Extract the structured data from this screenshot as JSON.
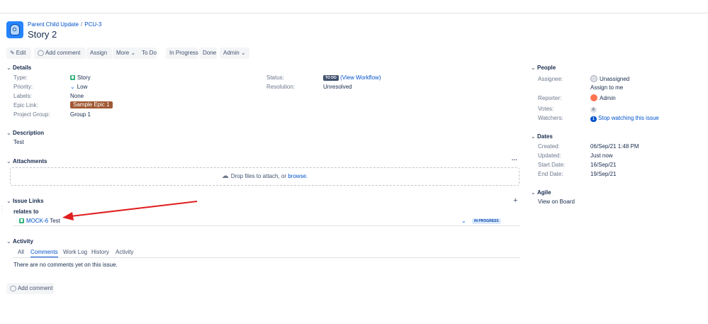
{
  "breadcrumb": {
    "project": "Parent Child Update",
    "issue_key": "PCU-3"
  },
  "issue": {
    "title": "Story 2"
  },
  "toolbar": {
    "edit": "Edit",
    "add_comment": "Add comment",
    "assign": "Assign",
    "more": "More",
    "todo": "To Do",
    "in_progress": "In Progress",
    "done": "Done",
    "admin": "Admin"
  },
  "details": {
    "heading": "Details",
    "type_label": "Type:",
    "type_value": "Story",
    "priority_label": "Priority:",
    "priority_value": "Low",
    "labels_label": "Labels:",
    "labels_value": "None",
    "epic_label": "Epic Link:",
    "epic_value": "Sample Epic 1",
    "group_label": "Project Group:",
    "group_value": "Group 1",
    "status_label": "Status:",
    "status_value": "TO DO",
    "view_workflow": "(View Workflow)",
    "resolution_label": "Resolution:",
    "resolution_value": "Unresolved"
  },
  "description": {
    "heading": "Description",
    "text": "Test"
  },
  "attachments": {
    "heading": "Attachments",
    "more": "···",
    "drop_text": "Drop files to attach, or",
    "browse": "browse."
  },
  "links": {
    "heading": "Issue Links",
    "add": "+",
    "relation": "relates to",
    "issue_key": "MOCK-6",
    "issue_summary": "Test",
    "status": "IN PROGRESS"
  },
  "activity": {
    "heading": "Activity",
    "tabs": [
      "All",
      "Comments",
      "Work Log",
      "History",
      "Activity"
    ],
    "empty": "There are no comments yet on this issue.",
    "add_comment": "Add comment"
  },
  "people": {
    "heading": "People",
    "assignee_label": "Assignee:",
    "assignee_value": "Unassigned",
    "assign_to_me": "Assign to me",
    "reporter_label": "Reporter:",
    "reporter_value": "Admin",
    "votes_label": "Votes:",
    "votes_value": "0",
    "watchers_label": "Watchers:",
    "watchers_count": "1",
    "watchers_action": "Stop watching this issue"
  },
  "dates": {
    "heading": "Dates",
    "created_label": "Created:",
    "created_value": "06/Sep/21 1:48 PM",
    "updated_label": "Updated:",
    "updated_value": "Just now",
    "start_label": "Start Date:",
    "start_value": "16/Sep/21",
    "end_label": "End Date:",
    "end_value": "19/Sep/21"
  },
  "agile": {
    "heading": "Agile",
    "link": "View on Board"
  },
  "colors": {
    "accent": "#0052cc",
    "epic": "#a05833",
    "annotation_arrow": "#e01e1e"
  }
}
